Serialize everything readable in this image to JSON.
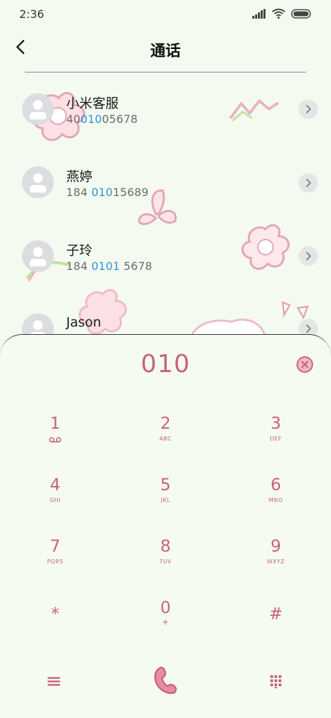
{
  "status_bar": {
    "time": "2:36"
  },
  "header": {
    "title": "通话"
  },
  "contacts": [
    {
      "name": "小米客服",
      "num_pre": "40",
      "num_hl": "010",
      "num_post": "05678"
    },
    {
      "name": "燕婷",
      "num_pre": "184 ",
      "num_hl": "010",
      "num_post": "15689"
    },
    {
      "name": "子玲",
      "num_pre": "184 ",
      "num_hl": "0101",
      "num_post": " 5678"
    },
    {
      "name": "Jason",
      "num_pre": "",
      "num_hl": "",
      "num_post": ""
    }
  ],
  "dialer": {
    "entered_number": "010",
    "keys": [
      {
        "digit": "1",
        "letters": ""
      },
      {
        "digit": "2",
        "letters": "ABC"
      },
      {
        "digit": "3",
        "letters": "DEF"
      },
      {
        "digit": "4",
        "letters": "GHI"
      },
      {
        "digit": "5",
        "letters": "JKL"
      },
      {
        "digit": "6",
        "letters": "MNO"
      },
      {
        "digit": "7",
        "letters": "PQRS"
      },
      {
        "digit": "8",
        "letters": "TUV"
      },
      {
        "digit": "9",
        "letters": "WXYZ"
      },
      {
        "digit": "*",
        "letters": ""
      },
      {
        "digit": "0",
        "letters": "+"
      },
      {
        "digit": "#",
        "letters": ""
      }
    ]
  },
  "colors": {
    "accent": "#c9647a",
    "highlight": "#2e93d8",
    "background": "#f4faef"
  },
  "icons": {
    "voicemail": "voicemail-icon",
    "menu": "menu-icon",
    "call": "phone-call-icon",
    "keypad": "keypad-grid-icon",
    "delete": "delete-backspace-icon"
  }
}
